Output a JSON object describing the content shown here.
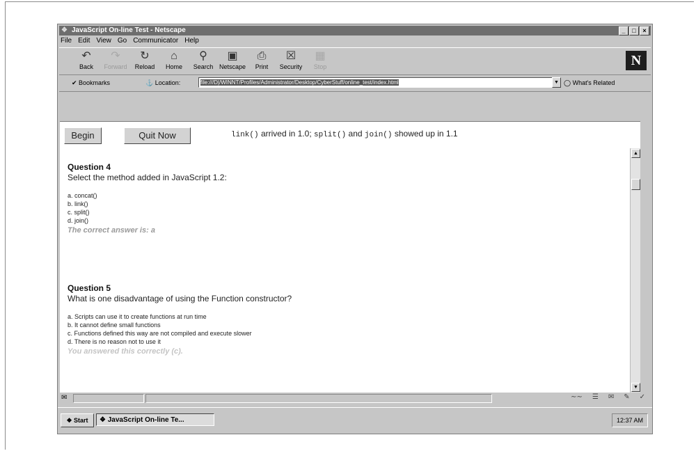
{
  "window": {
    "title": "JavaScript On-line Test - Netscape",
    "controls": [
      "_",
      "□",
      "×"
    ]
  },
  "menu": [
    "File",
    "Edit",
    "View",
    "Go",
    "Communicator",
    "Help"
  ],
  "toolbar": {
    "buttons": [
      {
        "label": "Back",
        "icon": "back-arrow-icon",
        "enabled": true
      },
      {
        "label": "Forward",
        "icon": "forward-arrow-icon",
        "enabled": false
      },
      {
        "label": "Reload",
        "icon": "reload-icon",
        "enabled": true
      },
      {
        "label": "Home",
        "icon": "home-icon",
        "enabled": true
      },
      {
        "label": "Search",
        "icon": "search-icon",
        "enabled": true
      },
      {
        "label": "Netscape",
        "icon": "netscape-icon",
        "enabled": true
      },
      {
        "label": "Print",
        "icon": "print-icon",
        "enabled": true
      },
      {
        "label": "Security",
        "icon": "lock-icon",
        "enabled": true
      },
      {
        "label": "Stop",
        "icon": "stop-icon",
        "enabled": false
      }
    ],
    "logo": "N"
  },
  "location": {
    "bookmarks_label": "Bookmarks",
    "label": "Location:",
    "url": "file:///D|/WINNT/Profiles/Administrator/Desktop/CyberStuff/online_test/index.html",
    "related_label": "What's Related"
  },
  "page": {
    "begin_button": "Begin",
    "quit_button": "Quit Now",
    "message": {
      "part1_code": "link()",
      "part1": " arrived in 1.0; ",
      "part2_code": "split()",
      "part2": " and ",
      "part3_code": "join()",
      "part3": " showed up in 1.1"
    },
    "questions": [
      {
        "heading": "Question 4",
        "text": "Select the method added in JavaScript 1.2:",
        "options": [
          "a. concat()",
          "b. link()",
          "c. split()",
          "d. join()"
        ],
        "result": "The correct answer is: a",
        "result_color": "#9a9a9a"
      },
      {
        "heading": "Question 5",
        "text": "What is one disadvantage of using the Function constructor?",
        "options": [
          "a. Scripts can use it to create functions at run time",
          "b. It cannot define small functions",
          "c. Functions defined this way are not compiled and execute slower",
          "d. There is no reason not to use it"
        ],
        "result": "You answered this correctly (c).",
        "result_color": "#c4c4c4"
      }
    ]
  },
  "taskbar": {
    "start_label": "Start",
    "task_label": "JavaScript On-line Te...",
    "clock": "12:37 AM"
  }
}
